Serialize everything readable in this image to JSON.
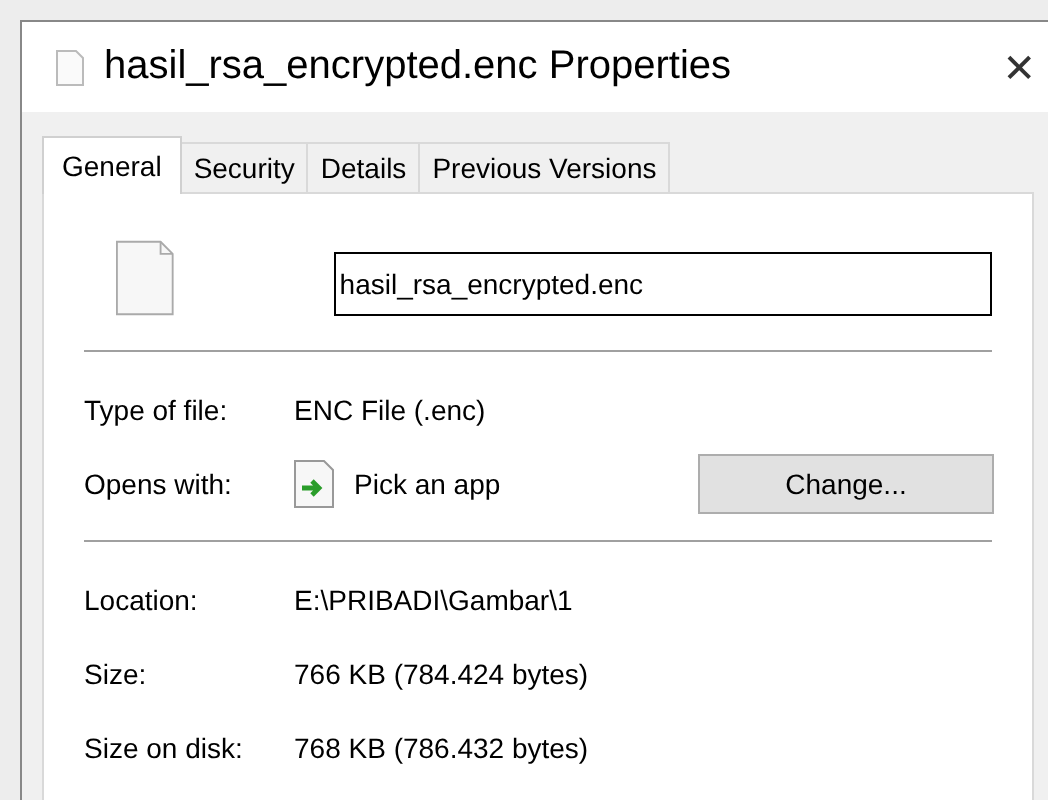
{
  "window": {
    "title": "hasil_rsa_encrypted.enc Properties",
    "close": "✕"
  },
  "tabs": [
    {
      "label": "General",
      "selected": true
    },
    {
      "label": "Security",
      "selected": false
    },
    {
      "label": "Details",
      "selected": false
    },
    {
      "label": "Previous Versions",
      "selected": false
    }
  ],
  "name_field": {
    "value": "hasil_rsa_encrypted.enc"
  },
  "sections": [
    [
      {
        "label": "Type of file:",
        "value": "ENC File (.enc)",
        "kind": "text"
      },
      {
        "label": "Opens with:",
        "value": "Pick an app",
        "kind": "app",
        "button": "Change..."
      }
    ],
    [
      {
        "label": "Location:",
        "value": "E:\\PRIBADI\\Gambar\\1",
        "kind": "text"
      },
      {
        "label": "Size:",
        "value": "766 KB (784.424 bytes)",
        "kind": "text"
      },
      {
        "label": "Size on disk:",
        "value": "768 KB (786.432 bytes)",
        "kind": "text"
      }
    ]
  ]
}
